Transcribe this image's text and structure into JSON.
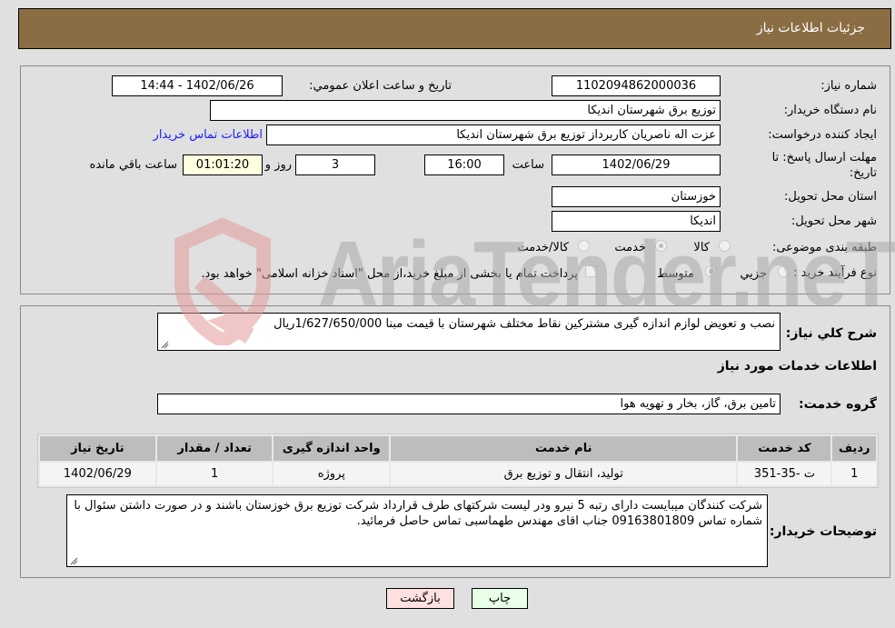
{
  "header": {
    "title": "جزئیات اطلاعات نیاز"
  },
  "form": {
    "need_number": {
      "label": "شماره نیاز:",
      "value": "1102094862000036"
    },
    "announce_datetime": {
      "label": "تاریخ و ساعت اعلان عمومي:",
      "value": "1402/06/26 - 14:44"
    },
    "buyer_org": {
      "label": "نام دستگاه خریدار:",
      "value": "توزیع برق شهرستان اندیکا"
    },
    "requester": {
      "label": "ایجاد کننده درخواست:",
      "value": "عزت اله ناصریان کاربرداز توزیع برق شهرستان اندیکا"
    },
    "buyer_contact_link": "اطلاعات تماس خریدار",
    "deadline": {
      "label": "مهلت ارسال پاسخ: تا تاریخ:",
      "date": "1402/06/29",
      "time_label": "ساعت",
      "time": "16:00",
      "days": "3",
      "days_label": "روز و",
      "remaining": "01:01:20",
      "remaining_label": "ساعت باقي مانده"
    },
    "province": {
      "label": "استان محل تحویل:",
      "value": "خوزستان"
    },
    "city": {
      "label": "شهر محل تحویل:",
      "value": "اندیکا"
    },
    "category": {
      "label": "طبقه بندی موضوعی:",
      "options": [
        "کالا",
        "خدمت",
        "کالا/خدمت"
      ],
      "selected": "خدمت"
    },
    "purchase_type": {
      "label": "نوع فرآیند خرید :",
      "options": [
        "جزيي",
        "متوسط"
      ],
      "selected": "متوسط",
      "treasury_note": "پرداخت تمام یا بخشی از مبلغ خرید،از محل \"اسناد خزانه اسلامی\" خواهد بود."
    }
  },
  "details": {
    "description_label": "شرح کلي نیاز:",
    "description": "نصب و تعویض لوازم اندازه گیری مشترکین نقاط مختلف شهرستان با قیمت مبنا 1/627/650/000ریال",
    "services_heading": "اطلاعات خدمات مورد نیاز",
    "service_group_label": "گروه خدمت:",
    "service_group": "تامین برق، گاز، بخار و تهویه هوا",
    "table": {
      "headers": [
        "ردیف",
        "کد خدمت",
        "نام خدمت",
        "واحد اندازه گیری",
        "تعداد / مقدار",
        "تاریخ نیاز"
      ],
      "rows": [
        [
          "1",
          "ت -35-351",
          "تولید، انتقال و توزیع برق",
          "پروژه",
          "1",
          "1402/06/29"
        ]
      ]
    },
    "buyer_notes_label": "توضیحات خریدار:",
    "buyer_notes": "شرکت کنندگان میبایست دارای رتبه 5 نیرو ودر لیست شرکتهای طرف قرارداد شرکت توزیع برق خوزستان باشند و در صورت داشتن سئوال با شماره تماس 09163801809 جناب اقای مهندس طهماسبی تماس حاصل فرمائید."
  },
  "buttons": {
    "print": "چاپ",
    "back": "بازگشت"
  },
  "watermark": {
    "text": "AriaTender.neT"
  },
  "colors": {
    "header_bg": "#8b6d43",
    "link": "#1a1aff",
    "back_btn": "#ffe0e0",
    "print_btn": "#e8ffe8"
  }
}
